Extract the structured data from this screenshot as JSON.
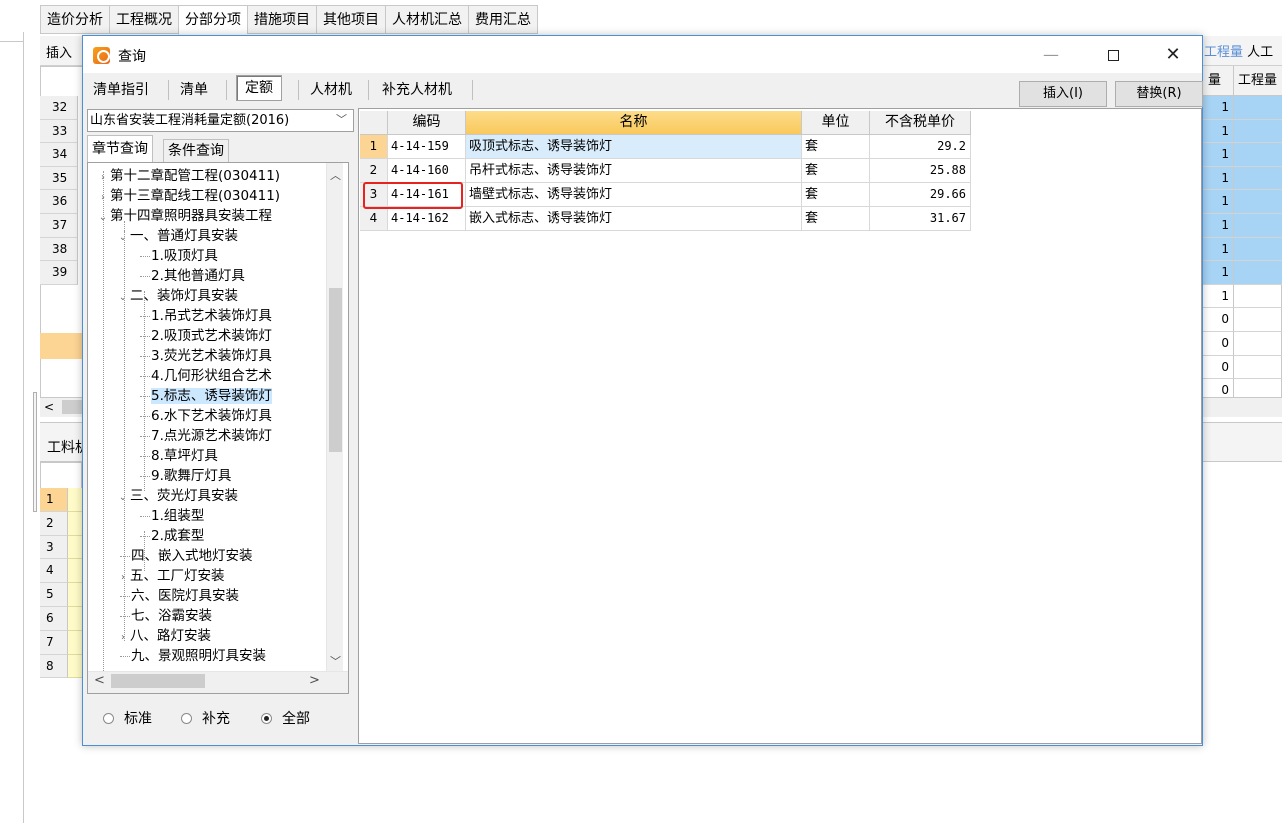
{
  "app_tabs": [
    "造价分析",
    "工程概况",
    "分部分项",
    "措施项目",
    "其他项目",
    "人材机汇总",
    "费用汇总"
  ],
  "app_tab_active": "分部分项",
  "bg_toolbar": {
    "insert_label": "插入",
    "right_label_a": "工程量",
    "right_label_b": "人工"
  },
  "bg_grid": {
    "header_col1": "量",
    "header_col2": "工程量",
    "row_numbers": [
      "32",
      "33",
      "34",
      "35",
      "36",
      "37",
      "38",
      "39"
    ],
    "col1_values": [
      "1",
      "1",
      "1",
      "1",
      "1",
      "1",
      "1",
      "1",
      "1",
      "0",
      "0",
      "0",
      "0"
    ]
  },
  "bg_bottom": {
    "label": "工料机",
    "row_numbers": [
      "1",
      "2",
      "3",
      "4",
      "5",
      "6",
      "7",
      "8"
    ]
  },
  "dialog": {
    "title": "查询",
    "window_controls": {
      "minimize": "—",
      "close": "✕"
    },
    "mode_tabs": [
      "清单指引",
      "清单",
      "定额",
      "人材机",
      "补充人材机"
    ],
    "mode_active": "定额",
    "insert_button": "插入(I)",
    "replace_button": "替换(R)",
    "quota_library": "山东省安装工程消耗量定额(2016)",
    "search_tabs": [
      "章节查询",
      "条件查询"
    ],
    "tree": [
      {
        "label": "第十二章配管工程(030411)",
        "level": 1,
        "arrow": "›"
      },
      {
        "label": "第十三章配线工程(030411)",
        "level": 1,
        "arrow": "›"
      },
      {
        "label": "第十四章照明器具安装工程",
        "level": 1,
        "arrow": "⌄"
      },
      {
        "label": "一、普通灯具安装",
        "level": 2,
        "arrow": "⌄"
      },
      {
        "label": "1.吸顶灯具",
        "level": 3
      },
      {
        "label": "2.其他普通灯具",
        "level": 3
      },
      {
        "label": "二、装饰灯具安装",
        "level": 2,
        "arrow": "⌄"
      },
      {
        "label": "1.吊式艺术装饰灯具",
        "level": 3
      },
      {
        "label": "2.吸顶式艺术装饰灯",
        "level": 3
      },
      {
        "label": "3.荧光艺术装饰灯具",
        "level": 3
      },
      {
        "label": "4.几何形状组合艺术",
        "level": 3
      },
      {
        "label": "5.标志、诱导装饰灯",
        "level": 3,
        "selected": true
      },
      {
        "label": "6.水下艺术装饰灯具",
        "level": 3
      },
      {
        "label": "7.点光源艺术装饰灯",
        "level": 3
      },
      {
        "label": "8.草坪灯具",
        "level": 3
      },
      {
        "label": "9.歌舞厅灯具",
        "level": 3
      },
      {
        "label": "三、荧光灯具安装",
        "level": 2,
        "arrow": "⌄"
      },
      {
        "label": "1.组装型",
        "level": 3
      },
      {
        "label": "2.成套型",
        "level": 3
      },
      {
        "label": "四、嵌入式地灯安装",
        "level": 2
      },
      {
        "label": "五、工厂灯安装",
        "level": 2,
        "arrow": "›"
      },
      {
        "label": "六、医院灯具安装",
        "level": 2
      },
      {
        "label": "七、浴霸安装",
        "level": 2
      },
      {
        "label": "八、路灯安装",
        "level": 2,
        "arrow": "›"
      },
      {
        "label": "九、景观照明灯具安装",
        "level": 2
      }
    ],
    "filters": [
      "标准",
      "补充",
      "全部"
    ],
    "filter_selected": "全部",
    "grid": {
      "columns": [
        "编码",
        "名称",
        "单位",
        "不含税单价"
      ],
      "rows": [
        {
          "idx": "1",
          "code": "4-14-159",
          "name": "吸顶式标志、诱导装饰灯",
          "unit": "套",
          "price": "29.2"
        },
        {
          "idx": "2",
          "code": "4-14-160",
          "name": "吊杆式标志、诱导装饰灯",
          "unit": "套",
          "price": "25.88"
        },
        {
          "idx": "3",
          "code": "4-14-161",
          "name": "墙壁式标志、诱导装饰灯",
          "unit": "套",
          "price": "29.66"
        },
        {
          "idx": "4",
          "code": "4-14-162",
          "name": "嵌入式标志、诱导装饰灯",
          "unit": "套",
          "price": "31.67"
        }
      ]
    }
  },
  "colors": {
    "accent": "#4a90d9",
    "highlight_box": "#e8231f",
    "name_header": "#f9c95c",
    "selected_row": "#d9ecfb",
    "tree_selection": "#cce8ff"
  }
}
